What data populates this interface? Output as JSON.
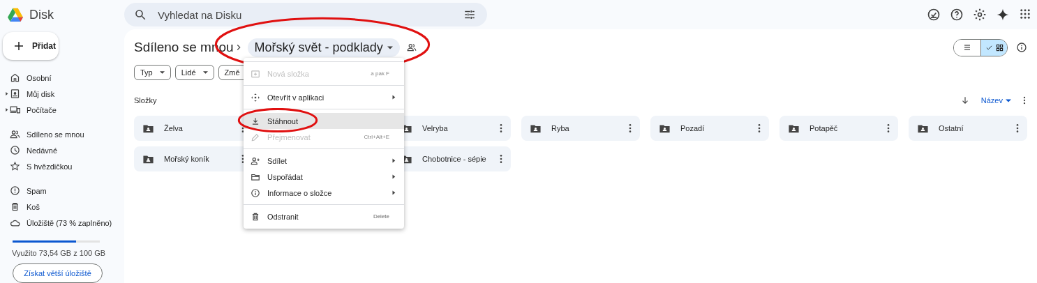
{
  "app": {
    "name": "Disk"
  },
  "search": {
    "placeholder": "Vyhledat na Disku"
  },
  "new_button": {
    "label": "Přidat"
  },
  "sidebar": {
    "groups": [
      [
        {
          "label": "Osobní",
          "expandable": false
        },
        {
          "label": "Můj disk",
          "expandable": true
        },
        {
          "label": "Počítače",
          "expandable": true
        }
      ],
      [
        {
          "label": "Sdíleno se mnou",
          "expandable": false
        },
        {
          "label": "Nedávné",
          "expandable": false
        },
        {
          "label": "S hvězdičkou",
          "expandable": false
        }
      ],
      [
        {
          "label": "Spam",
          "expandable": false
        },
        {
          "label": "Koš",
          "expandable": false
        },
        {
          "label": "Úložiště (73 % zaplněno)",
          "expandable": false
        }
      ]
    ],
    "storage": {
      "level": 0.73,
      "usage": "Využito 73,54 GB z 100 GB",
      "button": "Získat větší úložiště"
    }
  },
  "breadcrumb": {
    "parent": "Sdíleno se mnou",
    "current": "Mořský svět - podklady",
    "circled": true
  },
  "view_toggle": [
    {
      "kind": "list",
      "selected": false
    },
    {
      "kind": "grid",
      "selected": true
    }
  ],
  "filters": [
    "Typ",
    "Lidé",
    "Změ"
  ],
  "section_title": "Složky",
  "sort": {
    "label": "Název"
  },
  "folder_rows": [
    [
      {
        "name": "Želva"
      },
      {
        "name": "Velryba"
      },
      {
        "name": "Ryba"
      },
      {
        "name": "Pozadí"
      },
      {
        "name": "Potapěč"
      },
      {
        "name": "Ostatní"
      }
    ],
    [
      {
        "name": "Mořský koník"
      },
      {
        "name": "Chobotnice - sépie"
      }
    ]
  ],
  "context_menu": {
    "groups": [
      [
        {
          "label": "Nová složka",
          "disabled": true,
          "highlighted": false,
          "submenu": false,
          "shortcut": "a pak F",
          "circled": false
        }
      ],
      [
        {
          "label": "Otevřít v aplikaci",
          "disabled": false,
          "highlighted": false,
          "submenu": true,
          "circled": false
        }
      ],
      [
        {
          "label": "Stáhnout",
          "disabled": false,
          "highlighted": true,
          "submenu": false,
          "circled": true
        },
        {
          "label": "Přejmenovat",
          "disabled": true,
          "highlighted": false,
          "submenu": false,
          "shortcut": "Ctrl+Alt+E",
          "circled": false
        }
      ],
      [
        {
          "label": "Sdílet",
          "disabled": false,
          "highlighted": false,
          "submenu": true,
          "circled": false
        },
        {
          "label": "Uspořádat",
          "disabled": false,
          "highlighted": false,
          "submenu": true,
          "circled": false
        },
        {
          "label": "Informace o složce",
          "disabled": false,
          "highlighted": false,
          "submenu": true,
          "circled": false
        }
      ],
      [
        {
          "label": "Odstranit",
          "disabled": false,
          "highlighted": false,
          "submenu": false,
          "shortcut": "Delete",
          "circled": false
        }
      ]
    ]
  }
}
